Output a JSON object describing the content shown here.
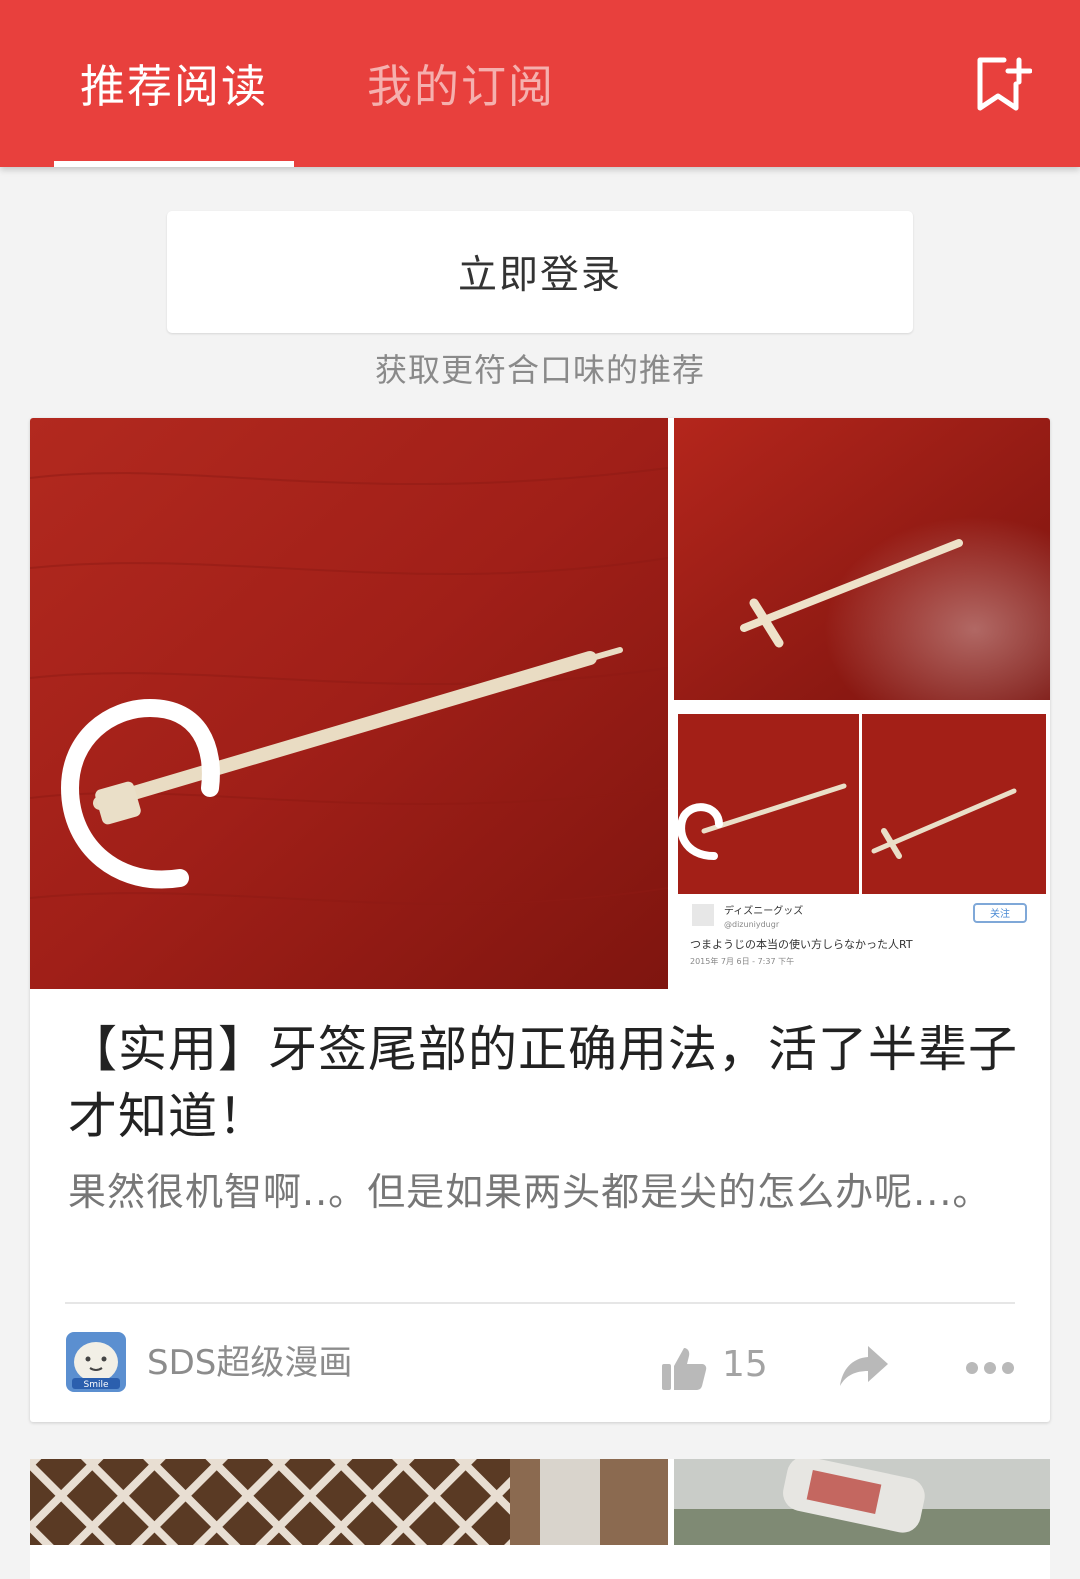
{
  "header": {
    "tabs": [
      {
        "label": "推荐阅读",
        "active": true
      },
      {
        "label": "我的订阅",
        "active": false
      }
    ],
    "bookmark_add_icon": "bookmark-add-icon",
    "background_color": "#e8403d"
  },
  "login": {
    "button_label": "立即登录",
    "hint": "获取更符合口味的推荐"
  },
  "article": {
    "title": "【实用】牙签尾部的正确用法，活了半辈子才知道！",
    "summary": "果然很机智啊..。但是如果两头都是尖的怎么办呢...。",
    "images": [
      "photo-toothpick-circled",
      "photo-toothpick-assembled",
      "photo-tweet-screenshot"
    ],
    "tweet": {
      "name": "ディズニーグッズ",
      "handle": "@dizuniydugr",
      "text": "つまようじの本当の使い方しらなかった人RT",
      "date": "2015年 7月 6日 - 7:37 下午",
      "follow": "关注"
    },
    "author": {
      "name": "SDS超级漫画",
      "avatar_text": "Smile"
    },
    "likes": "15",
    "like_icon": "thumbs-up-icon",
    "share_icon": "share-arrow-icon",
    "more_icon": "more-dots-icon"
  }
}
